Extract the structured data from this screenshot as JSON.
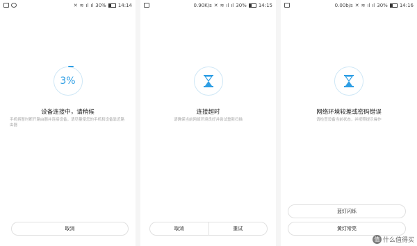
{
  "screens": [
    {
      "status": {
        "speed": "",
        "battery": "30%",
        "time": "14:14"
      },
      "ring_text": "3%",
      "title": "设备连接中，请稍候",
      "desc": "手机将暂时断开路由器并连接设备，请尽量使您的手机和设备靠近路由器",
      "buttons": [
        "取消"
      ]
    },
    {
      "status": {
        "speed": "0.90K/s",
        "battery": "30%",
        "time": "14:15"
      },
      "ring_icon": "hourglass-icon",
      "title": "连接超时",
      "desc": "请确保当前网络环境良好并尝试重新扫描",
      "buttons": [
        "取消",
        "重试"
      ]
    },
    {
      "status": {
        "speed": "0.00b/s",
        "battery": "30%",
        "time": "14:16"
      },
      "ring_icon": "hourglass-icon",
      "title": "网络环境较差或密码错误",
      "desc": "请检查设备当前状态，并按照提示操作",
      "buttons": [
        "蓝灯闪烁",
        "黄灯常亮"
      ]
    }
  ],
  "watermark": {
    "badge": "值",
    "text": "什么值得买"
  },
  "colors": {
    "accent": "#2e9ee4",
    "ring": "#cfe7f6"
  }
}
